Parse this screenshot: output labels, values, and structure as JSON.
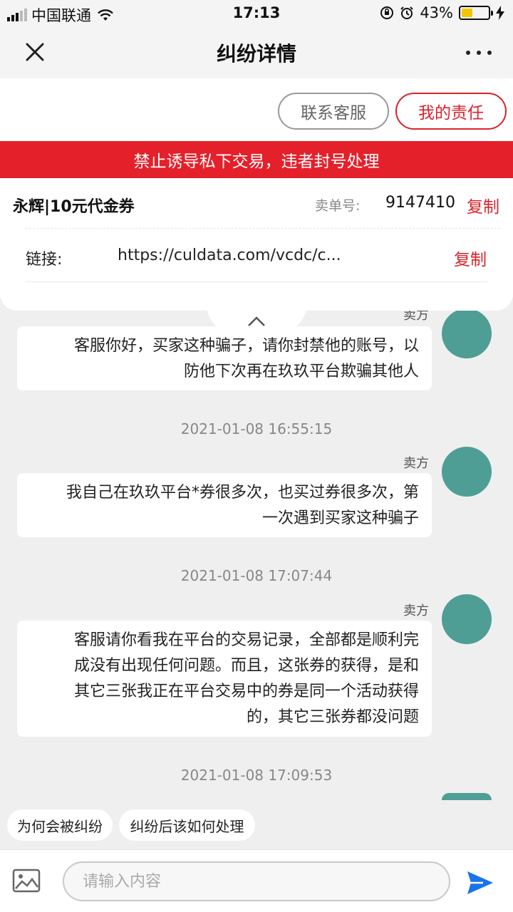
{
  "status_bar": {
    "carrier": "中国联通",
    "time": "17:13",
    "battery": "43%",
    "battery_level": 0.43
  },
  "nav": {
    "title": "纠纷详情"
  },
  "actions": {
    "contact_service": "联系客服",
    "my_responsibility": "我的责任"
  },
  "warning": "禁止诱导私下交易，违者封号处理",
  "order": {
    "product": "永辉|10元代金券",
    "order_label": "卖单号:",
    "order_number": "9147410",
    "copy": "复制",
    "link_label": "链接:",
    "link_value": "https://culdata.com/vcdc/c...",
    "link_copy": "复制"
  },
  "messages": [
    {
      "sender": "卖方",
      "lines": [
        "客服你好，买家这种骗子，请你封禁他的账号，以",
        "防他下次再在玖玖平台欺骗其他人"
      ]
    },
    {
      "timestamp": "2021-01-08 16:55:15",
      "sender": "卖方",
      "lines": [
        "我自己在玖玖平台*券很多次，也买过券很多次，第",
        "一次遇到买家这种骗子"
      ]
    },
    {
      "timestamp": "2021-01-08 17:07:44",
      "sender": "卖方",
      "lines": [
        "客服请你看我在平台的交易记录，全部都是顺利完",
        "成没有出现任何问题。而且，这张券的获得，是和",
        "其它三张我正在平台交易中的券是同一个活动获得",
        "的，其它三张券都没问题"
      ]
    },
    {
      "timestamp": "2021-01-08 17:09:53"
    }
  ],
  "quick_questions": [
    "为何会被纠纷",
    "纠纷后该如何处理"
  ],
  "input": {
    "placeholder": "请输入内容"
  },
  "icons": {
    "close": "close-icon",
    "more": "more-icon",
    "chevron": "chevron-up-icon",
    "image": "image-icon",
    "send": "send-icon"
  },
  "colors": {
    "accent_red": "#e4202a",
    "send_blue": "#1a73e8",
    "avatar_bg": "#4f9e96"
  }
}
